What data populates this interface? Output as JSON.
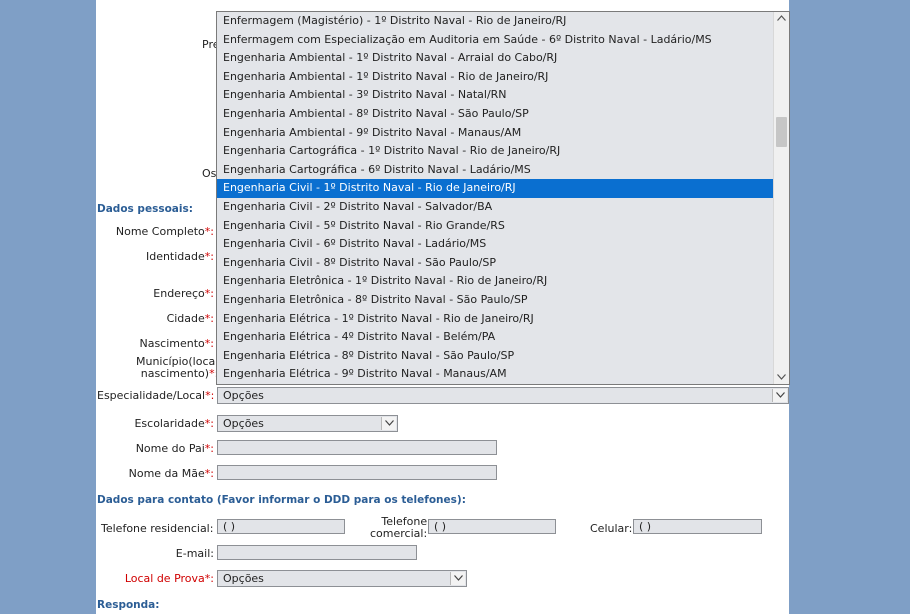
{
  "behind_labels": {
    "pre": "Pre",
    "os": "Os"
  },
  "sections": {
    "personal": "Dados pessoais:",
    "contact": "Dados para contato (Favor informar o DDD para os telefones):",
    "answer": "Responda:"
  },
  "labels": {
    "full_name": "Nome Completo",
    "identity": "Identidade",
    "address": "Endereço",
    "city": "Cidade",
    "birth": "Nascimento",
    "birthplace_line1": "Município(local",
    "birthplace_line2": "nascimento)",
    "specialty": "Especialidade/Local",
    "schooling": "Escolaridade",
    "father": "Nome do Pai",
    "mother": "Nome da Mãe",
    "home_phone": "Telefone residencial:",
    "work_phone_line1": "Telefone",
    "work_phone_line2": "comercial:",
    "cell": "Celular:",
    "email": "E-mail:",
    "exam_location": "Local de Prova",
    "required_mark": "*:"
  },
  "phone_value": "( )",
  "select_placeholder": "Opções",
  "dropdown": {
    "selected_index": 9,
    "options": [
      "Enfermagem (Magistério) - 1º Distrito Naval - Rio de Janeiro/RJ",
      "Enfermagem com Especialização em Auditoria em Saúde - 6º Distrito Naval - Ladário/MS",
      "Engenharia Ambiental - 1º Distrito Naval - Arraial do Cabo/RJ",
      "Engenharia Ambiental - 1º Distrito Naval - Rio de Janeiro/RJ",
      "Engenharia Ambiental - 3º Distrito Naval - Natal/RN",
      "Engenharia Ambiental - 8º Distrito Naval - São Paulo/SP",
      "Engenharia Ambiental - 9º Distrito Naval - Manaus/AM",
      "Engenharia Cartográfica - 1º Distrito Naval - Rio de Janeiro/RJ",
      "Engenharia Cartográfica - 6º Distrito Naval - Ladário/MS",
      "Engenharia Civil - 1º Distrito Naval - Rio de Janeiro/RJ",
      "Engenharia Civil - 2º Distrito Naval - Salvador/BA",
      "Engenharia Civil - 5º Distrito Naval - Rio Grande/RS",
      "Engenharia Civil - 6º Distrito Naval - Ladário/MS",
      "Engenharia Civil - 8º Distrito Naval - São Paulo/SP",
      "Engenharia Eletrônica - 1º Distrito Naval - Rio de Janeiro/RJ",
      "Engenharia Eletrônica - 8º Distrito Naval - São Paulo/SP",
      "Engenharia Elétrica - 1º Distrito Naval - Rio de Janeiro/RJ",
      "Engenharia Elétrica - 4º Distrito Naval - Belém/PA",
      "Engenharia Elétrica - 8º Distrito Naval - São Paulo/SP",
      "Engenharia Elétrica - 9º Distrito Naval - Manaus/AM"
    ]
  }
}
